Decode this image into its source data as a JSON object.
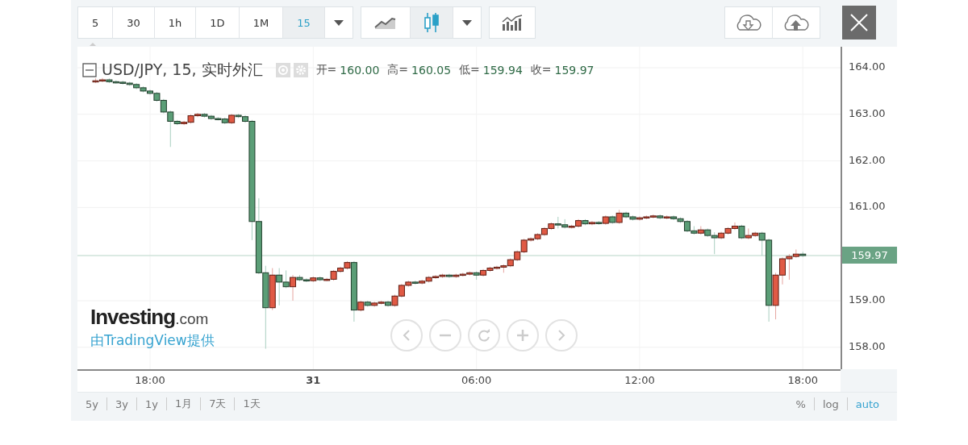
{
  "toolbar": {
    "intervals": [
      {
        "label": "5",
        "selected": false
      },
      {
        "label": "30",
        "selected": false
      },
      {
        "label": "1h",
        "selected": false
      },
      {
        "label": "1D",
        "selected": false
      },
      {
        "label": "1M",
        "selected": false
      },
      {
        "label": "15",
        "selected": true
      }
    ],
    "chart_styles": [
      {
        "kind": "line",
        "selected": false
      },
      {
        "kind": "candles",
        "selected": true
      }
    ]
  },
  "legend": {
    "symbol": "USD/JPY, 15, 实时外汇",
    "ohlc": [
      {
        "label": "开=",
        "value": "160.00"
      },
      {
        "label": "高=",
        "value": "160.05"
      },
      {
        "label": "低=",
        "value": "159.94"
      },
      {
        "label": "收=",
        "value": "159.97"
      }
    ]
  },
  "branding": {
    "logo": "Investing",
    "logo_suffix": ".com",
    "provider": "由TradingView提供"
  },
  "chart": {
    "chart_data": {
      "type": "candlestick",
      "grid": true,
      "ylim": [
        157.53,
        164.45
      ],
      "ref_lines": [
        {
          "axis": "y",
          "value": 159.97,
          "label": "159.97"
        }
      ],
      "categories": [
        null,
        null,
        null,
        null,
        null,
        null,
        null,
        null,
        "18:00",
        null,
        null,
        null,
        null,
        null,
        null,
        null,
        null,
        null,
        null,
        null,
        null,
        null,
        null,
        null,
        null,
        null,
        null,
        null,
        null,
        null,
        null,
        null,
        "31",
        null,
        null,
        null,
        null,
        null,
        null,
        null,
        null,
        null,
        null,
        null,
        null,
        null,
        null,
        null,
        null,
        null,
        null,
        null,
        null,
        null,
        null,
        null,
        "06:00",
        null,
        null,
        null,
        null,
        null,
        null,
        null,
        null,
        null,
        null,
        null,
        null,
        null,
        null,
        null,
        null,
        null,
        null,
        null,
        null,
        null,
        null,
        null,
        "12:00",
        null,
        null,
        null,
        null,
        null,
        null,
        null,
        null,
        null,
        null,
        null,
        null,
        null,
        null,
        null,
        null,
        null,
        null,
        null,
        null,
        null,
        null,
        null,
        "18:00"
      ],
      "ohlc": [
        [
          163.7,
          163.77,
          163.67,
          163.72
        ],
        [
          163.72,
          163.78,
          163.69,
          163.74
        ],
        [
          163.74,
          163.77,
          163.67,
          163.7
        ],
        [
          163.7,
          163.73,
          163.66,
          163.69
        ],
        [
          163.69,
          163.72,
          163.64,
          163.67
        ],
        [
          163.67,
          163.7,
          163.61,
          163.64
        ],
        [
          163.64,
          163.67,
          163.54,
          163.57
        ],
        [
          163.57,
          163.6,
          163.47,
          163.5
        ],
        [
          163.5,
          163.53,
          163.42,
          163.45
        ],
        [
          163.45,
          163.48,
          163.27,
          163.3
        ],
        [
          163.3,
          163.33,
          163.02,
          163.05
        ],
        [
          163.05,
          163.08,
          162.3,
          162.85
        ],
        [
          162.85,
          162.88,
          162.77,
          162.8
        ],
        [
          162.8,
          162.86,
          162.77,
          162.83
        ],
        [
          162.83,
          163.0,
          162.8,
          162.97
        ],
        [
          162.97,
          163.03,
          162.94,
          163.0
        ],
        [
          163.0,
          163.03,
          162.93,
          162.96
        ],
        [
          162.96,
          162.99,
          162.88,
          162.91
        ],
        [
          162.91,
          162.94,
          162.87,
          162.9
        ],
        [
          162.9,
          162.93,
          162.79,
          162.82
        ],
        [
          162.82,
          163.01,
          162.79,
          162.98
        ],
        [
          162.98,
          163.01,
          162.92,
          162.95
        ],
        [
          162.95,
          162.98,
          162.82,
          162.85
        ],
        [
          162.85,
          162.88,
          160.3,
          160.7
        ],
        [
          160.7,
          161.2,
          159.57,
          159.6
        ],
        [
          159.6,
          159.75,
          157.97,
          158.85
        ],
        [
          158.85,
          159.7,
          158.8,
          159.55
        ],
        [
          159.55,
          159.7,
          158.9,
          159.4
        ],
        [
          159.4,
          159.65,
          159.27,
          159.3
        ],
        [
          159.3,
          159.55,
          159.0,
          159.5
        ],
        [
          159.5,
          159.55,
          159.42,
          159.45
        ],
        [
          159.45,
          159.48,
          159.4,
          159.43
        ],
        [
          159.43,
          159.52,
          159.4,
          159.49
        ],
        [
          159.49,
          159.52,
          159.42,
          159.45
        ],
        [
          159.45,
          159.49,
          159.42,
          159.46
        ],
        [
          159.46,
          159.66,
          159.43,
          159.63
        ],
        [
          159.63,
          159.73,
          159.6,
          159.7
        ],
        [
          159.7,
          159.85,
          159.67,
          159.82
        ],
        [
          159.82,
          159.85,
          158.55,
          158.8
        ],
        [
          158.8,
          159.0,
          158.77,
          158.97
        ],
        [
          158.97,
          159.0,
          158.87,
          158.9
        ],
        [
          158.9,
          158.98,
          158.87,
          158.95
        ],
        [
          158.95,
          159.0,
          158.92,
          158.97
        ],
        [
          158.97,
          159.0,
          158.87,
          158.9
        ],
        [
          158.9,
          159.13,
          158.87,
          159.1
        ],
        [
          159.1,
          159.36,
          159.07,
          159.33
        ],
        [
          159.33,
          159.43,
          159.3,
          159.4
        ],
        [
          159.4,
          159.43,
          159.35,
          159.38
        ],
        [
          159.38,
          159.45,
          159.35,
          159.42
        ],
        [
          159.42,
          159.53,
          159.39,
          159.5
        ],
        [
          159.5,
          159.55,
          159.47,
          159.52
        ],
        [
          159.52,
          159.58,
          159.49,
          159.55
        ],
        [
          159.55,
          159.58,
          159.49,
          159.52
        ],
        [
          159.52,
          159.58,
          159.49,
          159.55
        ],
        [
          159.55,
          159.6,
          159.52,
          159.57
        ],
        [
          159.57,
          159.63,
          159.54,
          159.6
        ],
        [
          159.6,
          159.63,
          159.45,
          159.55
        ],
        [
          159.55,
          159.68,
          159.52,
          159.65
        ],
        [
          159.65,
          159.73,
          159.62,
          159.7
        ],
        [
          159.7,
          159.75,
          159.67,
          159.72
        ],
        [
          159.72,
          159.78,
          159.6,
          159.75
        ],
        [
          159.75,
          159.91,
          159.72,
          159.88
        ],
        [
          159.88,
          160.08,
          159.85,
          160.05
        ],
        [
          160.05,
          160.33,
          160.02,
          160.3
        ],
        [
          160.3,
          160.36,
          160.27,
          160.33
        ],
        [
          160.33,
          160.45,
          160.3,
          160.42
        ],
        [
          160.42,
          160.58,
          160.39,
          160.55
        ],
        [
          160.55,
          160.68,
          160.52,
          160.65
        ],
        [
          160.65,
          160.8,
          160.55,
          160.63
        ],
        [
          160.63,
          160.75,
          160.55,
          160.58
        ],
        [
          160.58,
          160.63,
          160.55,
          160.6
        ],
        [
          160.6,
          160.75,
          160.57,
          160.72
        ],
        [
          160.72,
          160.75,
          160.62,
          160.65
        ],
        [
          160.65,
          160.71,
          160.62,
          160.68
        ],
        [
          160.68,
          160.71,
          160.63,
          160.66
        ],
        [
          160.66,
          160.83,
          160.63,
          160.8
        ],
        [
          160.8,
          160.83,
          160.65,
          160.68
        ],
        [
          160.68,
          160.95,
          160.65,
          160.88
        ],
        [
          160.88,
          160.91,
          160.77,
          160.8
        ],
        [
          160.8,
          160.83,
          160.72,
          160.75
        ],
        [
          160.75,
          160.81,
          160.72,
          160.78
        ],
        [
          160.78,
          160.83,
          160.75,
          160.8
        ],
        [
          160.8,
          160.85,
          160.77,
          160.82
        ],
        [
          160.82,
          160.85,
          160.75,
          160.78
        ],
        [
          160.78,
          160.83,
          160.75,
          160.8
        ],
        [
          160.8,
          160.83,
          160.73,
          160.76
        ],
        [
          160.76,
          160.79,
          160.67,
          160.7
        ],
        [
          160.7,
          160.73,
          160.47,
          160.5
        ],
        [
          160.5,
          160.6,
          160.42,
          160.45
        ],
        [
          160.45,
          160.6,
          160.42,
          160.52
        ],
        [
          160.52,
          160.55,
          160.37,
          160.4
        ],
        [
          160.4,
          160.47,
          160.0,
          160.35
        ],
        [
          160.35,
          160.48,
          160.32,
          160.45
        ],
        [
          160.45,
          160.58,
          160.42,
          160.55
        ],
        [
          160.55,
          160.68,
          160.52,
          160.6
        ],
        [
          160.6,
          160.63,
          160.32,
          160.35
        ],
        [
          160.35,
          160.55,
          160.32,
          160.4
        ],
        [
          160.4,
          160.48,
          160.37,
          160.45
        ],
        [
          160.45,
          160.48,
          159.97,
          160.3
        ],
        [
          160.3,
          160.33,
          158.55,
          158.9
        ],
        [
          158.9,
          159.6,
          158.6,
          159.55
        ],
        [
          159.55,
          159.93,
          159.35,
          159.9
        ],
        [
          159.9,
          160.0,
          159.45,
          159.95
        ],
        [
          159.95,
          160.1,
          159.92,
          160.0
        ],
        [
          160.0,
          160.05,
          159.94,
          159.97
        ]
      ],
      "yticks": [
        {
          "value": 164,
          "label": "164.00"
        },
        {
          "value": 163,
          "label": "163.00"
        },
        {
          "value": 162,
          "label": "162.00"
        },
        {
          "value": 161,
          "label": "161.00"
        },
        {
          "value": 159,
          "label": "159.00"
        },
        {
          "value": 158,
          "label": "158.00"
        }
      ]
    }
  },
  "ranges": [
    "5y",
    "3y",
    "1y",
    "1月",
    "7天",
    "1天"
  ],
  "scale_options": [
    {
      "label": "%",
      "selected": false
    },
    {
      "label": "log",
      "selected": false
    },
    {
      "label": "auto",
      "selected": true
    }
  ]
}
